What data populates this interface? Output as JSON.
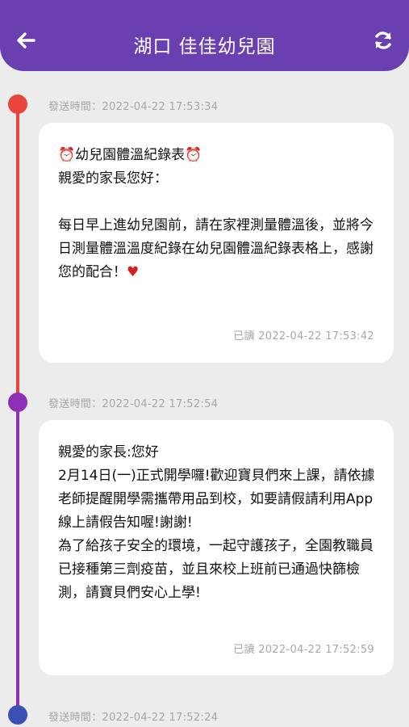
{
  "header": {
    "title": "湖口 佳佳幼兒園",
    "back_icon": "arrow-left-icon",
    "refresh_icon": "refresh-icon",
    "background": "#6a40b0"
  },
  "messages": [
    {
      "sent_time": "發送時間：2022-04-22 17:53:34",
      "body": "⏰幼兒園體溫紀錄表⏰\n親愛的家長您好：\n\n每日早上進幼兒園前，請在家裡測量體溫後，並將今日測量體溫溫度紀錄在幼兒園體溫紀錄表格上，感謝您的配合！♥",
      "read_time": "已讀 2022-04-22 17:53:42",
      "dot_color": "#e8453c"
    },
    {
      "sent_time": "發送時間：2022-04-22 17:52:54",
      "body": "親愛的家長:您好\n2月14日(一)正式開學囉!歡迎寶貝們來上課，請依據老師提醒開學需攜帶用品到校，如要請假請利用App線上請假告知喔!謝謝!\n為了給孩子安全的環境，一起守護孩子，全園教職員已接種第三劑疫苗，並且來校上班前已通過快篩檢測，請寶貝們安心上學!",
      "read_time": "已讀 2022-04-22 17:52:59",
      "dot_color": "#8e2fb8"
    },
    {
      "sent_time": "發送時間：2022-04-22 17:52:24",
      "dot_color": "#3b51b5"
    }
  ]
}
